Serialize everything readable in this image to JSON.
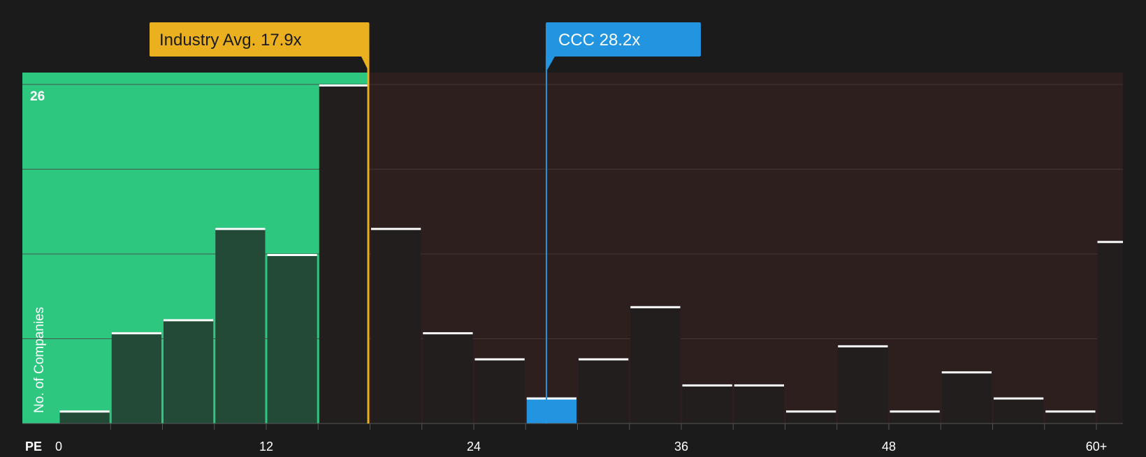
{
  "chart_data": {
    "type": "bar",
    "y_axis_label": "No. of Companies",
    "x_axis_label": "PE",
    "top_tick_label": "26",
    "x_tick_labels": [
      "0",
      "12",
      "24",
      "36",
      "48",
      "60+"
    ],
    "x_tick_values": [
      0,
      12,
      24,
      36,
      48,
      60
    ],
    "ylim": [
      0,
      26
    ],
    "bin_width": 3,
    "bins": [
      {
        "x_start": 0,
        "x_end": 3,
        "value": 1
      },
      {
        "x_start": 3,
        "x_end": 6,
        "value": 7
      },
      {
        "x_start": 6,
        "x_end": 9,
        "value": 8
      },
      {
        "x_start": 9,
        "x_end": 12,
        "value": 15
      },
      {
        "x_start": 12,
        "x_end": 15,
        "value": 13
      },
      {
        "x_start": 15,
        "x_end": 18,
        "value": 26
      },
      {
        "x_start": 18,
        "x_end": 21,
        "value": 15
      },
      {
        "x_start": 21,
        "x_end": 24,
        "value": 7
      },
      {
        "x_start": 24,
        "x_end": 27,
        "value": 5
      },
      {
        "x_start": 27,
        "x_end": 30,
        "value": 2
      },
      {
        "x_start": 30,
        "x_end": 33,
        "value": 5
      },
      {
        "x_start": 33,
        "x_end": 36,
        "value": 9
      },
      {
        "x_start": 36,
        "x_end": 39,
        "value": 3
      },
      {
        "x_start": 39,
        "x_end": 42,
        "value": 3
      },
      {
        "x_start": 42,
        "x_end": 45,
        "value": 1
      },
      {
        "x_start": 45,
        "x_end": 48,
        "value": 6
      },
      {
        "x_start": 48,
        "x_end": 51,
        "value": 1
      },
      {
        "x_start": 51,
        "x_end": 54,
        "value": 4
      },
      {
        "x_start": 54,
        "x_end": 57,
        "value": 2
      },
      {
        "x_start": 57,
        "x_end": 60,
        "value": 1
      },
      {
        "x_start": 60,
        "x_end": 63,
        "value": 14
      }
    ],
    "industry_avg": {
      "label": "Industry Avg. 17.9x",
      "value": 17.9
    },
    "company": {
      "label": "CCC 28.2x",
      "value": 28.2
    },
    "highlighted_bin_index": 9,
    "colors": {
      "background": "#1b1b1b",
      "below_avg_region": "#2ec780",
      "above_avg_region": "#2e1f1f",
      "bar_below": "#224a37",
      "bar_above": "#231e1e",
      "bar_highlight": "#2394e0",
      "bar_cap": "#ffffff",
      "industry_callout": "#eab020",
      "company_callout": "#2394e0",
      "gridline": "#4a3c3c",
      "text": "#ffffff",
      "callout_text_dark": "#1b1b1b"
    }
  }
}
